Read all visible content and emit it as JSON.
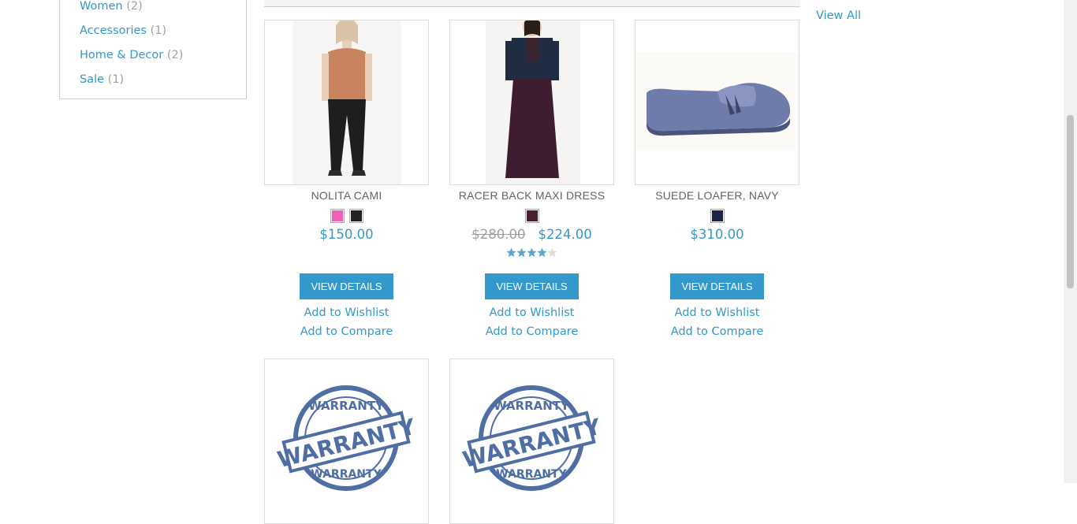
{
  "sidebar": {
    "categories": [
      {
        "name": "Women",
        "count": "(2)"
      },
      {
        "name": "Accessories",
        "count": "(1)"
      },
      {
        "name": "Home & Decor",
        "count": "(2)"
      },
      {
        "name": "Sale",
        "count": "(1)"
      }
    ]
  },
  "right_column": {
    "view_all": "View All"
  },
  "products": [
    {
      "name": "NOLITA CAMI",
      "price": "$150.00",
      "swatch_colors": [
        "#f060b8",
        "#222222"
      ],
      "button": "VIEW DETAILS",
      "wishlist": "Add to Wishlist",
      "compare": "Add to Compare"
    },
    {
      "name": "RACER BACK MAXI DRESS",
      "old_price": "$280.00",
      "price": "$224.00",
      "swatch_colors": [
        "#4a2030"
      ],
      "rating": 0.8,
      "button": "VIEW DETAILS",
      "wishlist": "Add to Wishlist",
      "compare": "Add to Compare"
    },
    {
      "name": "SUEDE LOAFER, NAVY",
      "price": "$310.00",
      "swatch_colors": [
        "#1c2548"
      ],
      "button": "VIEW DETAILS",
      "wishlist": "Add to Wishlist",
      "compare": "Add to Compare"
    }
  ],
  "warranty_images": [
    {
      "top_text": "WARRANTY",
      "main_text": "WARRANTY",
      "bottom_text": "WARRANTY"
    },
    {
      "top_text": "WARRANTY",
      "main_text": "WARRANTY",
      "bottom_text": "WARRANTY"
    }
  ],
  "colors": {
    "accent": "#3399cc",
    "muted": "#a0a0a0",
    "text": "#636363"
  }
}
